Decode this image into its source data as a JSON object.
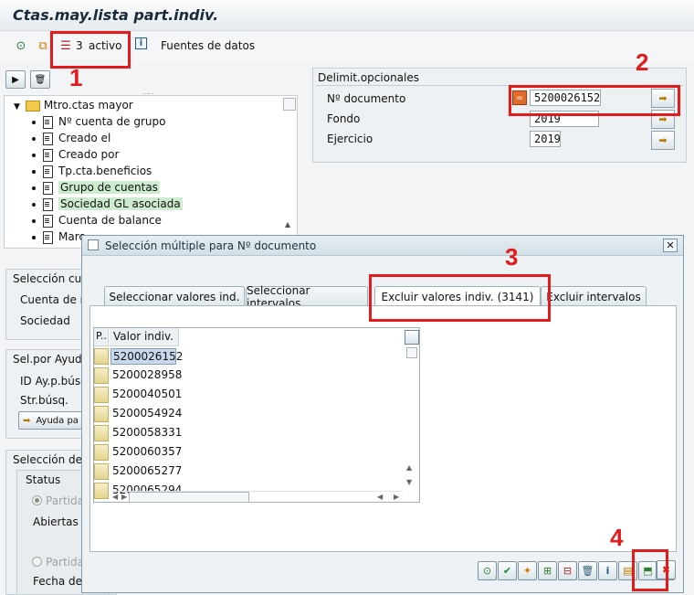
{
  "window": {
    "title": "Ctas.may.lista part.indiv."
  },
  "toolbar": {
    "active_count": "3",
    "active_label": "activo",
    "datasources_label": "Fuentes de datos"
  },
  "tree": {
    "root": "Mtro.ctas mayor",
    "items": [
      "Nº cuenta de grupo",
      "Creado el",
      "Creado por",
      "Tp.cta.beneficios",
      "Grupo de cuentas",
      "Sociedad GL asociada",
      "Cuenta de balance",
      "Marc..."
    ]
  },
  "delimit": {
    "title": "Delimit.opcionales",
    "fields": [
      {
        "label": "Nº documento",
        "value": "5200026152"
      },
      {
        "label": "Fondo",
        "value": "2019"
      },
      {
        "label": "Ejercicio",
        "value": "2019"
      }
    ]
  },
  "background_sections": {
    "sel_cuentas": "Selección cue",
    "cuenta_de": "Cuenta de m",
    "sociedad": "Sociedad",
    "sel_ayuda": "Sel.por Ayuda",
    "id_ayuda": "ID Ay.p.búso",
    "str_busq": "Str.búsq.",
    "ayuda_btn": "Ayuda pa",
    "sel_partidas": "Selección de p",
    "status": "Status",
    "partidas1": "Partidas",
    "abiertas": "Abiertas e",
    "partidas2": "Partidas",
    "fecha": "Fecha de"
  },
  "dialog": {
    "title": "Selección múltiple para Nº documento",
    "tabs": [
      "Seleccionar valores ind.",
      "Seleccionar intervalos",
      "Excluir valores indiv. (3141)",
      "Excluir intervalos"
    ],
    "grid": {
      "col_p": "P..",
      "col_value": "Valor indiv.",
      "rows": [
        "5200026152",
        "5200028958",
        "5200040501",
        "5200054924",
        "5200058331",
        "5200060357",
        "5200065277",
        "5200065294"
      ]
    }
  },
  "annotations": [
    "1",
    "2",
    "3",
    "4"
  ],
  "colors": {
    "annotation": "#e31b1b",
    "highlight": "#cdebcf"
  }
}
